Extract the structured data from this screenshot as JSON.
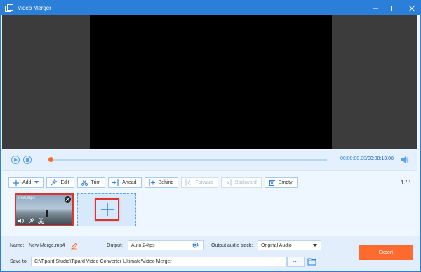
{
  "window": {
    "title": "Video Merger",
    "controls": {
      "minimize": "—",
      "maximize": "☐",
      "close": "✕"
    }
  },
  "colors": {
    "titlebar": "#2b7fd9",
    "accent": "#2b7fd9",
    "progress_thumb": "#ff6a1f",
    "export_button": "#ff6a2f",
    "highlight_border": "#e0322f"
  },
  "playback": {
    "current_time": "00:00:00.00",
    "separator": "/",
    "total_time": "00:00:13.08",
    "progress": 0
  },
  "toolbar": {
    "add": "Add",
    "edit": "Edit",
    "trim": "Trim",
    "ahead": "Ahead",
    "behind": "Behind",
    "forward": "Forward",
    "backward": "Backward",
    "empty": "Empty"
  },
  "pager": "1 / 1",
  "clips": [
    {
      "name": "new.mp4"
    }
  ],
  "bottom": {
    "name_label": "Name:",
    "name_value": "New Merge.mp4",
    "output_label": "Output:",
    "output_value": "Auto;24fps",
    "audio_label": "Output audio track:",
    "audio_value": "Original Audio",
    "save_label": "Save to:",
    "save_path": "C:\\Tipard Studio\\Tipard Video Converter Ultimate\\Video Merger",
    "browse": "···",
    "export": "Export"
  },
  "icons": {
    "play": "play-icon",
    "stop": "stop-icon",
    "volume": "volume-icon",
    "pencil": "pencil-icon",
    "gear": "gear-icon",
    "folder": "folder-icon",
    "plus": "plus-icon"
  }
}
